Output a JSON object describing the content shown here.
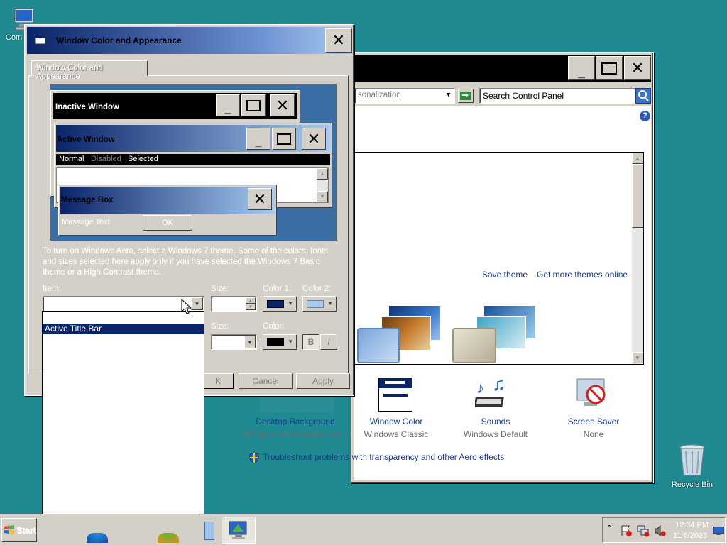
{
  "desktop": {
    "computer_label": "Com",
    "recycle_label": "Recycle Bin"
  },
  "personalization": {
    "address_text": "sonalization",
    "search_placeholder": "Search Control Panel",
    "save_theme": "Save theme",
    "get_more": "Get more themes online",
    "bottom_items": [
      {
        "name": "Desktop Background",
        "sub": "Windows-8-consumer-pre..."
      },
      {
        "name": "Window Color",
        "sub": "Windows Classic"
      },
      {
        "name": "Sounds",
        "sub": "Windows Default"
      },
      {
        "name": "Screen Saver",
        "sub": "None"
      }
    ],
    "troubleshoot": "Troubleshoot problems with transparency and other Aero effects"
  },
  "dialog": {
    "title": "Window Color and Appearance",
    "tab": "Window Color and Appearance",
    "preview": {
      "inactive": "Inactive Window",
      "active": "Active Window",
      "menu_normal": "Normal",
      "menu_disabled": "Disabled",
      "menu_selected": "Selected",
      "message_box": "Message Box",
      "message_text": "Message Text",
      "ok": "OK"
    },
    "description": "To turn on Windows Aero, select a Windows 7 theme.  Some of the colors, fonts, and sizes selected here apply only if you have selected the Windows 7 Basic theme or a High Contrast theme.",
    "item_label": "Item:",
    "size_label": "Size:",
    "color1_label": "Color 1:",
    "color2_label": "Color 2:",
    "size2_label": "Size:",
    "color_label": "Color:",
    "bold_glyph": "B",
    "italic_glyph": "I",
    "ok_btn_partial": "K",
    "cancel_btn": "Cancel",
    "apply_btn": "Apply",
    "dropdown_items": [
      "",
      "Active Title Bar"
    ],
    "dropdown_selected_index": 1,
    "colors": {
      "color1": "#0a246a",
      "color2": "#a6caf0",
      "font_color": "#000000"
    }
  },
  "taskbar": {
    "start": "Start",
    "time": "12:34 PM",
    "date": "11/6/2023"
  }
}
